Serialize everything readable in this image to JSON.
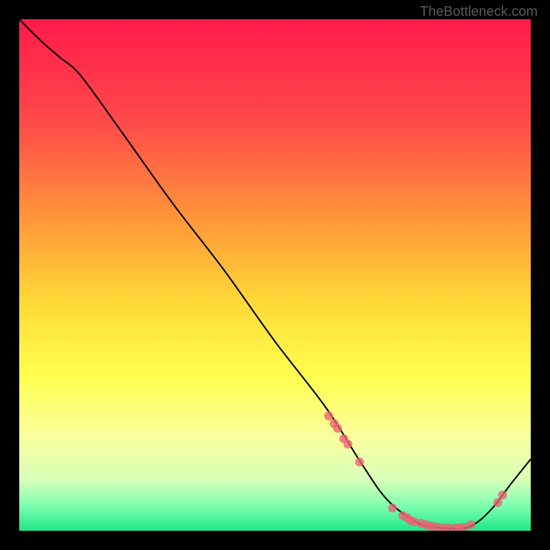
{
  "watermark": "TheBottleneck.com",
  "chart_data": {
    "type": "line",
    "title": "",
    "xlabel": "",
    "ylabel": "",
    "xlim": [
      0,
      100
    ],
    "ylim": [
      0,
      100
    ],
    "background_gradient": {
      "stops": [
        {
          "offset": 0,
          "color": "#ff1a4a"
        },
        {
          "offset": 20,
          "color": "#ff4a4a"
        },
        {
          "offset": 40,
          "color": "#ff9a38"
        },
        {
          "offset": 55,
          "color": "#ffd838"
        },
        {
          "offset": 70,
          "color": "#ffff50"
        },
        {
          "offset": 82,
          "color": "#f8ffa0"
        },
        {
          "offset": 90,
          "color": "#d8ffb8"
        },
        {
          "offset": 95,
          "color": "#80ffb0"
        },
        {
          "offset": 100,
          "color": "#20e888"
        }
      ]
    },
    "curve": {
      "x": [
        0,
        4,
        8,
        12,
        20,
        30,
        40,
        50,
        60,
        67,
        72,
        78,
        83,
        87,
        90,
        93,
        96,
        100
      ],
      "y": [
        100,
        96,
        92.5,
        89,
        78,
        64,
        51,
        37,
        24,
        13,
        6,
        1.5,
        0.5,
        0.5,
        2,
        5,
        9,
        14
      ]
    },
    "markers": [
      {
        "x": 60.5,
        "y": 22.5
      },
      {
        "x": 61.5,
        "y": 21
      },
      {
        "x": 62.2,
        "y": 20
      },
      {
        "x": 63.5,
        "y": 18
      },
      {
        "x": 64.2,
        "y": 17
      },
      {
        "x": 66.5,
        "y": 13.5
      },
      {
        "x": 73,
        "y": 4.5
      },
      {
        "x": 75,
        "y": 3
      },
      {
        "x": 75.8,
        "y": 2.5
      },
      {
        "x": 76.5,
        "y": 2
      },
      {
        "x": 77.2,
        "y": 1.8
      },
      {
        "x": 78.5,
        "y": 1.5
      },
      {
        "x": 79.5,
        "y": 1.2
      },
      {
        "x": 80.2,
        "y": 1
      },
      {
        "x": 81,
        "y": 0.8
      },
      {
        "x": 82,
        "y": 0.7
      },
      {
        "x": 83,
        "y": 0.6
      },
      {
        "x": 84,
        "y": 0.5
      },
      {
        "x": 85.2,
        "y": 0.5
      },
      {
        "x": 86,
        "y": 0.6
      },
      {
        "x": 87,
        "y": 0.7
      },
      {
        "x": 88.3,
        "y": 1.2
      },
      {
        "x": 93.5,
        "y": 5.5
      },
      {
        "x": 94.5,
        "y": 7
      }
    ]
  }
}
